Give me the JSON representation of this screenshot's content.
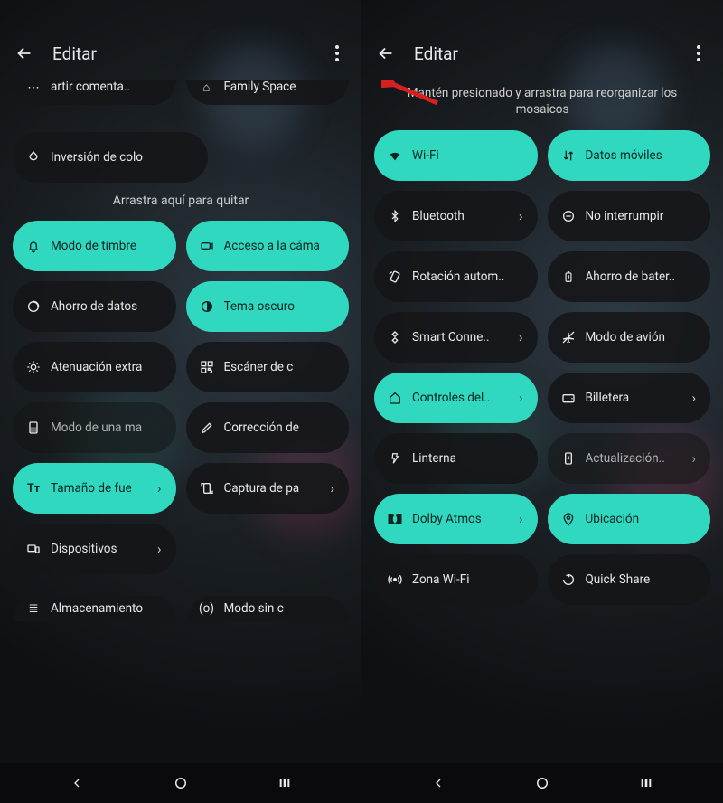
{
  "screen1": {
    "title": "Editar",
    "top_tiles": [
      {
        "icon": "dots-icon",
        "label": "artir comenta.."
      },
      {
        "icon": "family-icon",
        "label": "Family Space"
      }
    ],
    "color_inv_label": "Inversión de colo",
    "remove_hint": "Arrastra aquí para quitar",
    "grid": [
      {
        "icon": "bell-icon",
        "label": "Modo de timbre",
        "active": true
      },
      {
        "icon": "camera-icon",
        "label": "Acceso a la cáma",
        "active": true
      },
      {
        "icon": "data-saver-icon",
        "label": "Ahorro de datos",
        "active": false
      },
      {
        "icon": "contrast-icon",
        "label": "Tema oscuro",
        "active": true
      },
      {
        "icon": "dim-icon",
        "label": "Atenuación extra",
        "active": false
      },
      {
        "icon": "qr-icon",
        "label": "Escáner de c",
        "active": false
      },
      {
        "icon": "onehand-icon",
        "label": "Modo de una ma",
        "active": false,
        "dim": true
      },
      {
        "icon": "pencil-icon",
        "label": "Corrección de",
        "active": false
      },
      {
        "icon": "font-icon",
        "label": "Tamaño de fue",
        "active": true,
        "chev": true
      },
      {
        "icon": "screenshot-icon",
        "label": "Captura de pa",
        "active": false,
        "chev": true
      },
      {
        "icon": "devices-icon",
        "label": "Dispositivos",
        "active": false,
        "chev": true,
        "span": true
      }
    ],
    "bottom_cut": [
      {
        "icon": "storage-icon",
        "label": "Almacenamiento"
      },
      {
        "icon": "offline-icon",
        "label": "Modo sin c"
      }
    ]
  },
  "screen2": {
    "title": "Editar",
    "hint": "Mantén presionado y arrastra para reorganizar los mosaicos",
    "grid": [
      {
        "icon": "wifi-icon",
        "label": "Wi-Fi",
        "active": true
      },
      {
        "icon": "swap-icon",
        "label": "Datos móviles",
        "active": true
      },
      {
        "icon": "bluetooth-icon",
        "label": "Bluetooth",
        "active": false,
        "chev": true
      },
      {
        "icon": "dnd-icon",
        "label": "No interrumpir",
        "active": false
      },
      {
        "icon": "rotate-icon",
        "label": "Rotación autom..",
        "active": false
      },
      {
        "icon": "battery-icon",
        "label": "Ahorro de bater..",
        "active": false
      },
      {
        "icon": "smart-icon",
        "label": "Smart Conne..",
        "active": false,
        "chev": true
      },
      {
        "icon": "airplane-icon",
        "label": "Modo de avión",
        "active": false
      },
      {
        "icon": "home-icon",
        "label": "Controles del..",
        "active": true,
        "chev": true
      },
      {
        "icon": "wallet-icon",
        "label": "Billetera",
        "active": false,
        "chev": true
      },
      {
        "icon": "flash-icon",
        "label": "Linterna",
        "active": false
      },
      {
        "icon": "update-icon",
        "label": "Actualización..",
        "active": false,
        "dim": true,
        "chev": true
      },
      {
        "icon": "dolby-icon",
        "label": "Dolby Atmos",
        "active": true,
        "chev": true
      },
      {
        "icon": "location-icon",
        "label": "Ubicación",
        "active": true
      },
      {
        "icon": "hotspot-icon",
        "label": "Zona Wi-Fi",
        "active": false
      },
      {
        "icon": "share-icon",
        "label": "Quick Share",
        "active": false
      }
    ]
  },
  "icons": {
    "bell-icon": "🔔",
    "camera-icon": "📷",
    "data-saver-icon": "◔",
    "contrast-icon": "◐",
    "dim-icon": "☀",
    "qr-icon": "▦",
    "onehand-icon": "▢",
    "pencil-icon": "✎",
    "font-icon": "Tᴛ",
    "screenshot-icon": "⧉",
    "devices-icon": "🖧",
    "storage-icon": "≣",
    "offline-icon": "(o)",
    "dots-icon": "⋯",
    "family-icon": "⌂",
    "invert-icon": "◉",
    "wifi-icon": "▲",
    "swap-icon": "⇅",
    "bluetooth-icon": "BT",
    "dnd-icon": "⊖",
    "rotate-icon": "⟳",
    "battery-icon": "▯",
    "smart-icon": "◈",
    "airplane-icon": "✈",
    "home-icon": "⌂",
    "wallet-icon": "▣",
    "flash-icon": "⚡",
    "update-icon": "⟳",
    "dolby-icon": "▮▮",
    "location-icon": "◎",
    "hotspot-icon": "◉",
    "share-icon": "↻"
  }
}
